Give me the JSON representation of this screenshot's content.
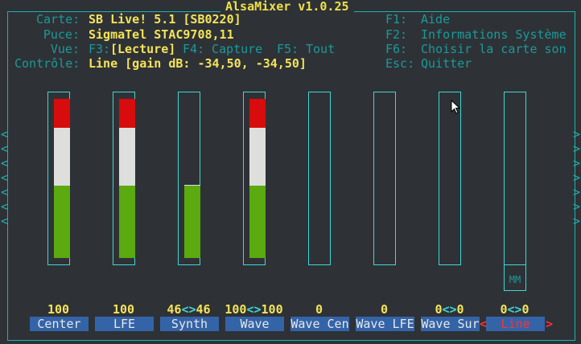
{
  "title": "AlsaMixer v1.0.25",
  "info": [
    {
      "label": "Carte:",
      "value": "SB Live! 5.1 [SB0220]"
    },
    {
      "label": "Puce:",
      "value": "SigmaTel STAC9708,11"
    },
    {
      "label": "Contrôle:",
      "value": "Line [gain dB: -34,50, -34,50]"
    }
  ],
  "view": {
    "label": "Vue:",
    "f3": "F3:",
    "playback": "[Lecture]",
    "f4": "F4:",
    "capture": "Capture",
    "f5": "F5:",
    "all": "Tout"
  },
  "keys": [
    {
      "key": "F1:",
      "action": "Aide"
    },
    {
      "key": "F2:",
      "action": "Informations Système"
    },
    {
      "key": "F6:",
      "action": "Choisir la carte son"
    },
    {
      "key": "Esc:",
      "action": "Quitter"
    }
  ],
  "controls": [
    {
      "name": "Center",
      "value": "100",
      "volume": 100,
      "stereo": false
    },
    {
      "name": "LFE",
      "value": "100",
      "volume": 100,
      "stereo": false
    },
    {
      "name": "Synth",
      "left": "46",
      "right": "46",
      "volume": 46,
      "stereo": true
    },
    {
      "name": "Wave",
      "left": "100",
      "right": "100",
      "volume": 100,
      "stereo": true
    },
    {
      "name": "Wave Cen",
      "value": "0",
      "volume": 0,
      "stereo": false
    },
    {
      "name": "Wave LFE",
      "value": "0",
      "volume": 0,
      "stereo": false
    },
    {
      "name": "Wave Sur",
      "left": "0",
      "right": "0",
      "volume": 0,
      "stereo": true
    },
    {
      "name": "Line",
      "left": "0",
      "right": "0",
      "volume": 0,
      "stereo": true,
      "selected": true,
      "muted_label": "MM"
    }
  ],
  "colors": {
    "border": "#1fb0b0",
    "label": "#1a9a9a",
    "value": "#f5e35a",
    "name_bg": "#3464a8",
    "selected": "#ff3030",
    "green": "#5aaa10",
    "white": "#dedfdc",
    "red": "#d80c0c"
  }
}
